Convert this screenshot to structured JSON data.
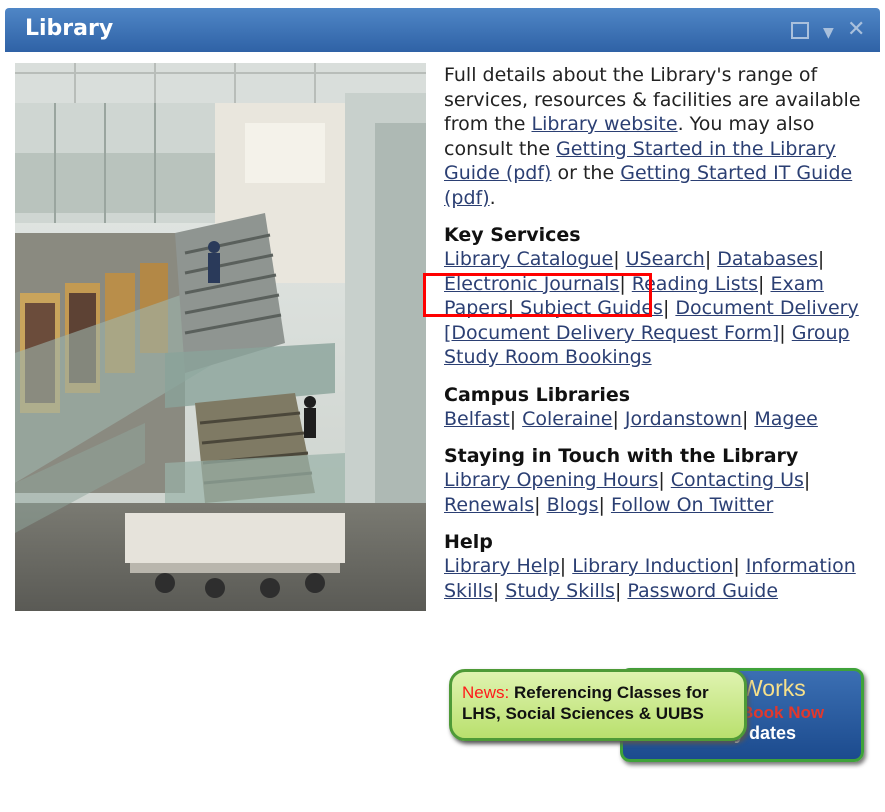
{
  "window": {
    "title": "Library",
    "controls": {
      "maximize_icon": "maximize-icon",
      "menu_icon": "dropdown-icon",
      "close_icon": "close-icon",
      "menu_glyph": "▼",
      "close_glyph": "✕"
    }
  },
  "intro": {
    "t1": "Full details about the Library's range of services, resources & facilities are available from the ",
    "l1": "Library website",
    "t2": ". You may also consult the ",
    "l2": "Getting Started in the Library Guide (pdf)",
    "t3": " or the ",
    "l3": "Getting Started IT Guide (pdf)",
    "t4": "."
  },
  "key_services": {
    "heading": "Key Services",
    "links": [
      "Library Catalogue",
      "USearch",
      "Databases",
      "Electronic Journals",
      "Reading Lists",
      "Exam Papers",
      "Subject Guides",
      "Document Delivery",
      "[Document Delivery Request Form]",
      "Group Study Room Bookings"
    ]
  },
  "campus": {
    "heading": "Campus Libraries",
    "links": [
      "Belfast",
      "Coleraine",
      "Jordanstown",
      "Magee"
    ]
  },
  "touch": {
    "heading": "Staying in Touch with the Library",
    "links": [
      "Library Opening Hours",
      "Contacting Us",
      "Renewals",
      "Blogs",
      "Follow On Twitter"
    ]
  },
  "help": {
    "heading": "Help",
    "links": [
      "Library Help",
      "Library Induction",
      "Information Skills",
      "Study Skills",
      "Password Guide"
    ]
  },
  "separator": "|",
  "banner": {
    "news_label": "News:",
    "line1": " Referencing Classes for",
    "line2": "LHS, Social Sciences & UUBS",
    "back_t1": "Works",
    "back_t2": "Book Now",
    "back_t3": "ary dates"
  },
  "colors": {
    "titlebar": "#3a70b5",
    "link": "#2b3f73",
    "highlight": "#ff0000",
    "news": "#ff1a1a"
  }
}
